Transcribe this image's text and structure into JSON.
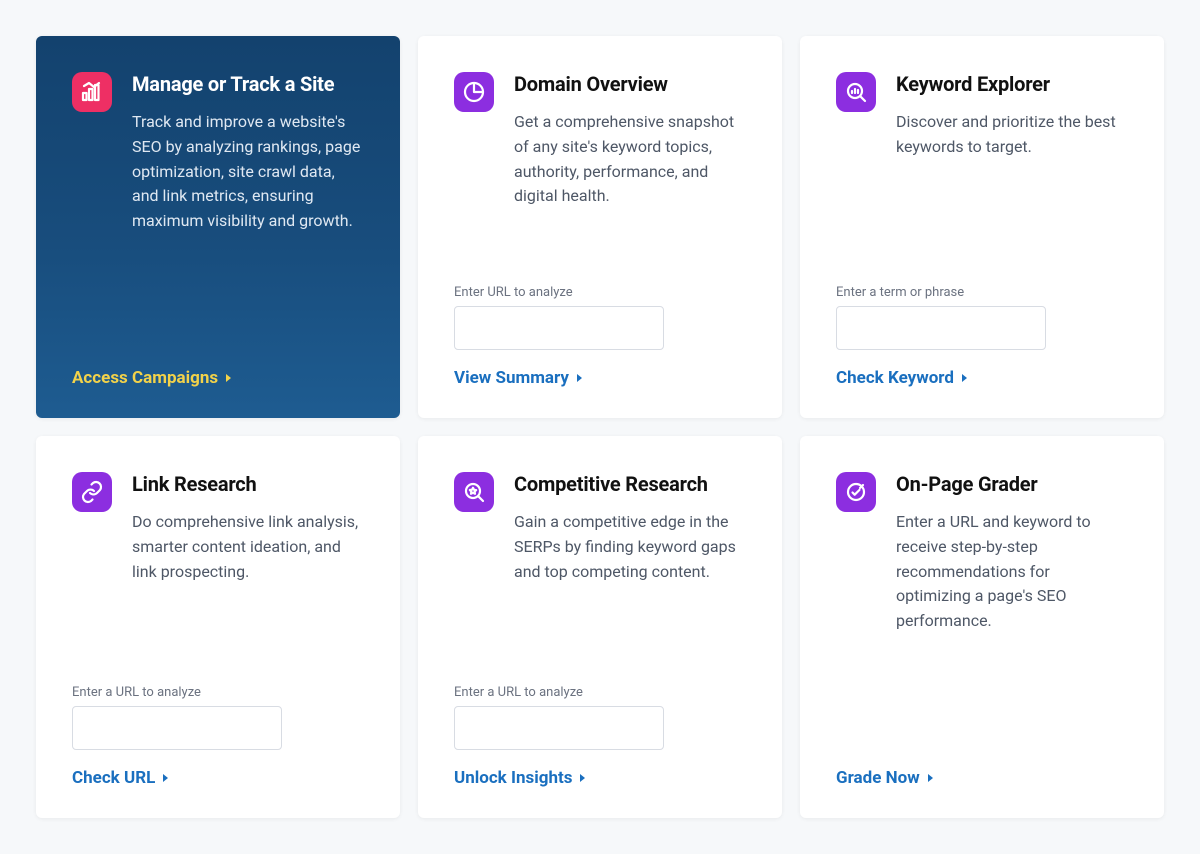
{
  "cards": [
    {
      "title": "Manage or Track a Site",
      "desc": "Track and improve a website's SEO by analyzing rankings, page optimization, site crawl data, and link metrics, ensuring maximum visibility and growth.",
      "action": "Access Campaigns",
      "featured": true,
      "icon": "bar-chart-up-icon",
      "icon_color": "pink",
      "has_input": false
    },
    {
      "title": "Domain Overview",
      "desc": "Get a comprehensive snapshot of any site's keyword topics, authority, performance, and digital health.",
      "action": "View Summary",
      "featured": false,
      "icon": "pie-chart-icon",
      "icon_color": "purple",
      "has_input": true,
      "input_label": "Enter URL to analyze"
    },
    {
      "title": "Keyword Explorer",
      "desc": "Discover and prioritize the best keywords to target.",
      "action": "Check Keyword",
      "featured": false,
      "icon": "magnify-chart-icon",
      "icon_color": "purple",
      "has_input": true,
      "input_label": "Enter a term or phrase"
    },
    {
      "title": "Link Research",
      "desc": "Do comprehensive link analysis, smarter content ideation, and link prospecting.",
      "action": "Check URL",
      "featured": false,
      "icon": "link-icon",
      "icon_color": "purple",
      "has_input": true,
      "input_label": "Enter a URL to analyze"
    },
    {
      "title": "Competitive Research",
      "desc": "Gain a competitive edge in the SERPs by finding keyword gaps and top competing content.",
      "action": "Unlock Insights",
      "featured": false,
      "icon": "star-magnify-icon",
      "icon_color": "purple",
      "has_input": true,
      "input_label": "Enter a URL to analyze"
    },
    {
      "title": "On-Page Grader",
      "desc": "Enter a URL and keyword to receive step-by-step recommendations for optimizing a page's SEO performance.",
      "action": "Grade Now",
      "featured": false,
      "icon": "target-check-icon",
      "icon_color": "purple",
      "has_input": false
    }
  ]
}
